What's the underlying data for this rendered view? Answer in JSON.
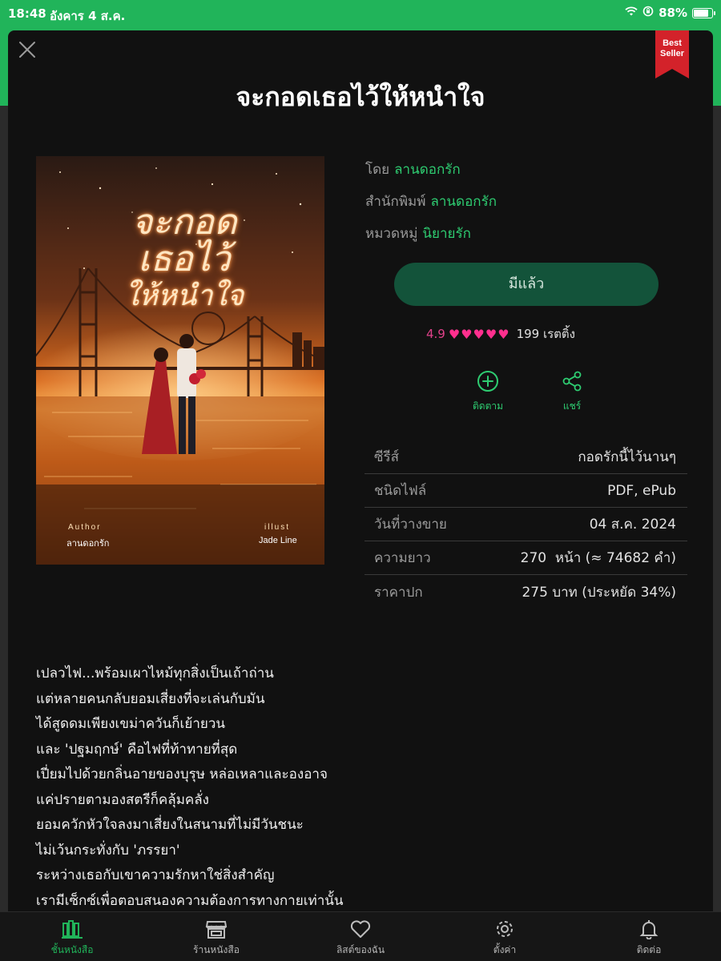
{
  "status_bar": {
    "time": "18:48",
    "date": "อังคาร 4 ส.ค.",
    "battery": "88%",
    "battery_level": 0.88
  },
  "badge": {
    "line1": "Best",
    "line2": "Seller"
  },
  "book": {
    "title": "จะกอดเธอไว้ให้หนำใจ",
    "author_label": "โดย",
    "author": "ลานดอกรัก",
    "publisher_label": "สำนักพิมพ์",
    "publisher": "ลานดอกรัก",
    "category_label": "หมวดหมู่",
    "category": "นิยายรัก"
  },
  "cover": {
    "title_line1": "จะกอด",
    "title_line2": "เธอไว้",
    "title_line3": "ให้หนำใจ",
    "author_label": "Author",
    "author_name": "ลานดอกรัก",
    "illust_label": "illust",
    "illust_name": "Jade Line"
  },
  "owned_button": "มีแล้ว",
  "rating": {
    "score": "4.9",
    "hearts": "♥♥♥♥♥",
    "count": "199 เรตติ้ง",
    "heart_color": "#ff2f8e"
  },
  "actions": {
    "follow": {
      "label": "ติดตาม",
      "icon": "plus-circle-icon"
    },
    "share": {
      "label": "แชร์",
      "icon": "share-icon"
    }
  },
  "details": [
    {
      "key": "ซีรีส์",
      "value": "กอดรักนี้ไว้นานๆ"
    },
    {
      "key": "ชนิดไฟล์",
      "value": "PDF, ePub"
    },
    {
      "key": "วันที่วางขาย",
      "value": "04 ส.ค. 2024"
    },
    {
      "key": "ความยาว",
      "value": "270  หน้า (≈ 74682 คำ)"
    },
    {
      "key": "ราคาปก",
      "value": "275 บาท (ประหยัด 34%)"
    }
  ],
  "synopsis": [
    "เปลวไฟ...พร้อมเผาไหม้ทุกสิ่งเป็นเถ้าถ่าน",
    "แต่หลายคนกลับยอมเสี่ยงที่จะเล่นกับมัน",
    "ได้สูดดมเพียงเขม่าควันก็เย้ายวน",
    "และ 'ปฐมฤกษ์' คือไฟที่ท้าทายที่สุด",
    "เปี่ยมไปด้วยกลิ่นอายของบุรุษ หล่อเหลาและองอาจ",
    "แค่ปรายตามองสตรีก็คลุ้มคลั่ง",
    "ยอมควักหัวใจลงมาเสี่ยงในสนามที่ไม่มีวันชนะ",
    "ไม่เว้นกระทั่งกับ 'ภรรยา'",
    "ระหว่างเธอกับเขาความรักหาใช่สิ่งสำคัญ",
    "เรามีเซ็กซ์เพื่อตอบสนองความต้องการทางกายเท่านั้น"
  ],
  "bottom_nav": [
    {
      "label": "ชั้นหนังสือ",
      "icon": "bookshelf-icon",
      "active": true
    },
    {
      "label": "ร้านหนังสือ",
      "icon": "store-icon",
      "active": false
    },
    {
      "label": "ลิสต์ของฉัน",
      "icon": "heart-icon",
      "active": false
    },
    {
      "label": "ตั้งค่า",
      "icon": "gear-icon",
      "active": false
    },
    {
      "label": "ติดต่อ",
      "icon": "bell-icon",
      "active": false
    }
  ],
  "colors": {
    "accent_green": "#21b45a",
    "link_green": "#2ecc71",
    "owned_button_bg": "#13533a",
    "ribbon_red": "#d3222a",
    "background": "#111111"
  }
}
